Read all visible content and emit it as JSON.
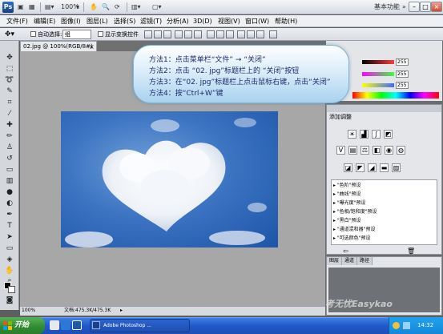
{
  "app": {
    "logo_text": "Ps",
    "zoom_level": "100%",
    "workspace_label": "基本功能"
  },
  "menu": [
    "文件(F)",
    "编辑(E)",
    "图像(I)",
    "图层(L)",
    "选择(S)",
    "滤镜(T)",
    "分析(A)",
    "3D(D)",
    "视图(V)",
    "窗口(W)",
    "帮助(H)"
  ],
  "options": {
    "auto_select_label": "自动选择:",
    "auto_select_value": "组",
    "transform_label": "显示变换控件"
  },
  "document": {
    "tab_label": "02.jpg @ 100%(RGB/8#)",
    "close_glyph": "×",
    "status_zoom": "100%",
    "status_doc": "文档:475.3K/475.3K"
  },
  "color_panel": {
    "values": [
      "255",
      "255",
      "255"
    ],
    "slider_colors": [
      "#ff3b3b",
      "#3bff3b",
      "#3b6bff"
    ]
  },
  "adjustments": {
    "title": "添加调整",
    "presets": [
      "\"色阶\"预设",
      "\"曲线\"预设",
      "\"曝光度\"预设",
      "\"色相/饱和度\"预设",
      "\"黑白\"预设",
      "\"通道混和器\"预设",
      "\"可选颜色\"预设"
    ]
  },
  "layers_panel": {
    "tabs": [
      "图层",
      "通道",
      "路径"
    ]
  },
  "callout": {
    "lines": [
      "方法1：点击菜单栏“文件” → “关闭”",
      "方法2：点击 “02. jpg”标题栏上的 “关闭”按钮",
      "方法3：在“02. jpg”标题栏上点击鼠标右键，点击“关闭”",
      "方法4：按“Ctrl+W”键"
    ]
  },
  "taskbar": {
    "start_label": "开始",
    "task_item": "Adobe Photoshop ...",
    "clock": "14:32"
  },
  "watermark": "考无忧Easykao"
}
